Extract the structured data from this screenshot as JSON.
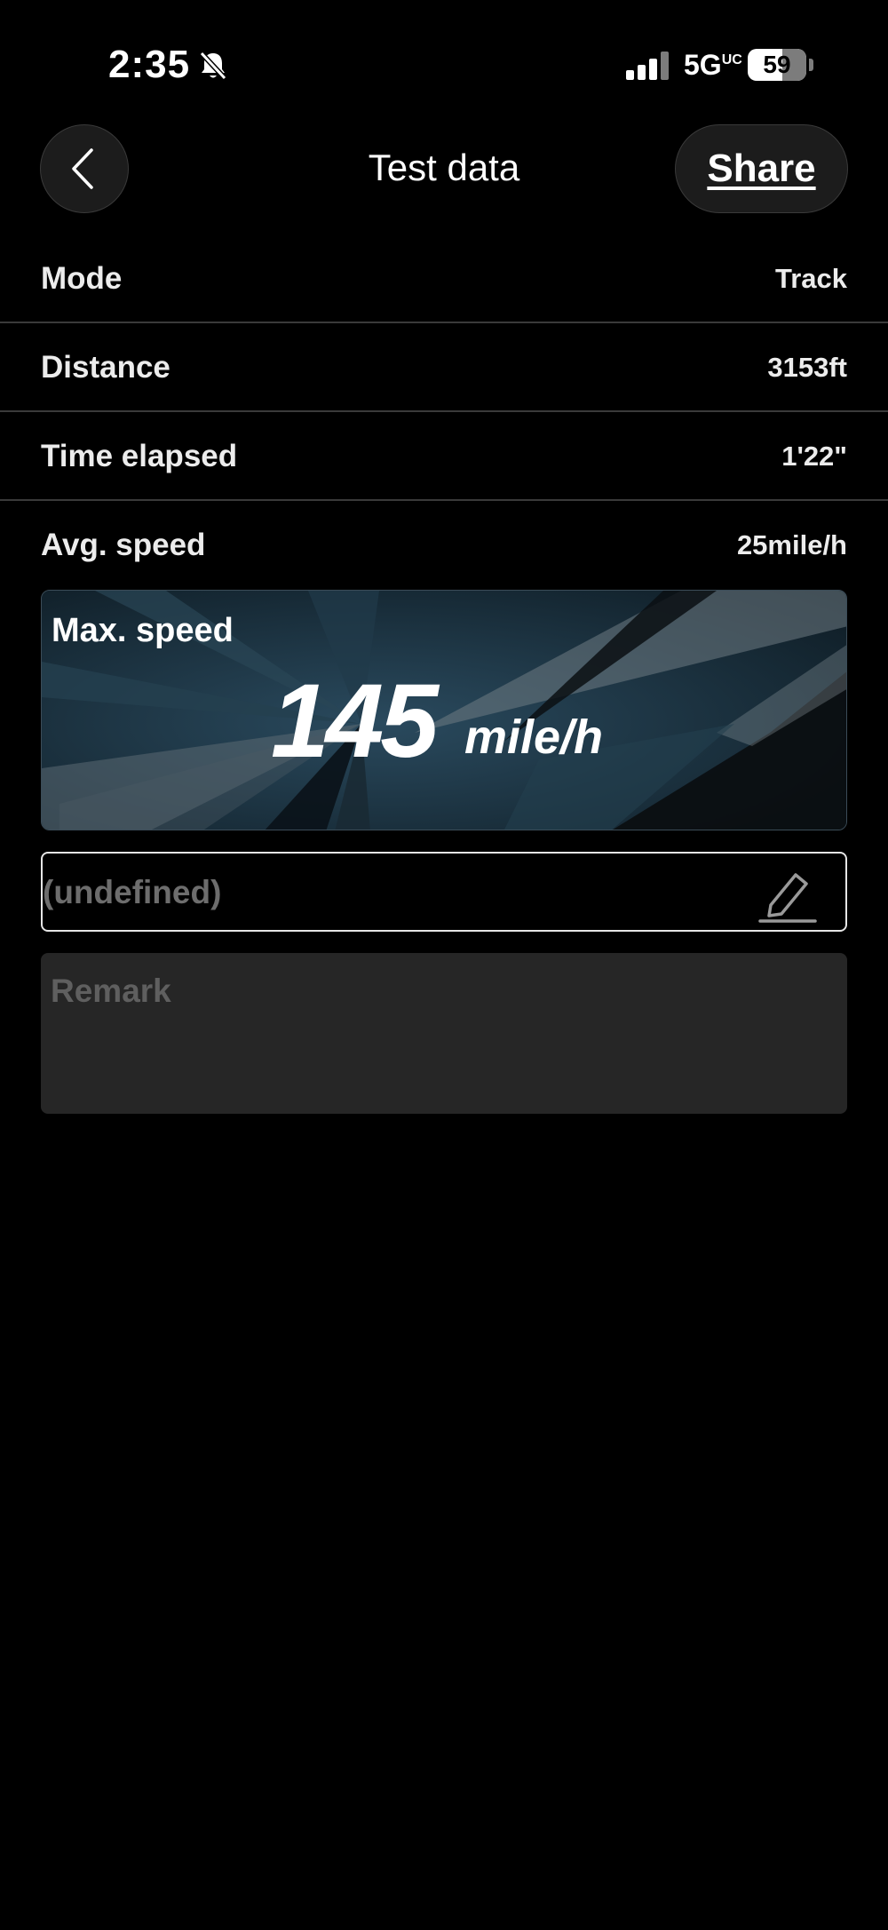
{
  "status_bar": {
    "time": "2:35",
    "network": "5G",
    "network_suffix": "UC",
    "battery": "59"
  },
  "header": {
    "title": "Test data",
    "share_label": "Share"
  },
  "rows": [
    {
      "label": "Mode",
      "value": "Track"
    },
    {
      "label": "Distance",
      "value": "3153ft"
    },
    {
      "label": "Time elapsed",
      "value": "1'22\""
    },
    {
      "label": "Avg. speed",
      "value": "25mile/h"
    }
  ],
  "max_speed": {
    "label": "Max. speed",
    "value": "145",
    "unit": "mile/h"
  },
  "name_field": {
    "placeholder": "(undefined)"
  },
  "remark": {
    "placeholder": "Remark"
  },
  "colors": {
    "background": "#000000",
    "card_blue": "#1d3a4d",
    "remark_bg": "#262626"
  }
}
